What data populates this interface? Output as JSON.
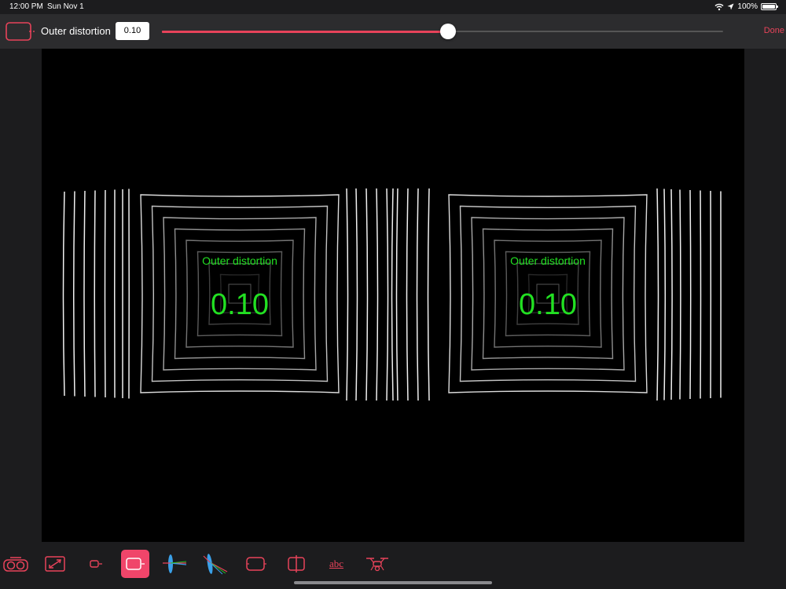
{
  "status": {
    "time": "12:00 PM",
    "date": "Sun Nov 1",
    "battery": "100%"
  },
  "toolbar": {
    "label": "Outer distortion",
    "value": "0.10",
    "slider_fraction": 0.51,
    "done_label": "Done"
  },
  "viewport": {
    "left_eye": {
      "label": "Outer distortion",
      "value": "0.10"
    },
    "right_eye": {
      "label": "Outer distortion",
      "value": "0.10"
    }
  },
  "bottom_tools": [
    {
      "name": "headset-tool",
      "icon": "vr-goggles-icon",
      "active": false
    },
    {
      "name": "scale-tool",
      "icon": "resize-diagonal-icon",
      "active": false
    },
    {
      "name": "inner-distortion-tool",
      "icon": "small-lens-icon",
      "active": false
    },
    {
      "name": "outer-distortion-tool",
      "icon": "large-lens-icon",
      "active": true
    },
    {
      "name": "lens-blue-tool",
      "icon": "lens-refraction-icon",
      "active": false
    },
    {
      "name": "lens-chromatic-tool",
      "icon": "chromatic-aberration-icon",
      "active": false
    },
    {
      "name": "screen-tool",
      "icon": "screen-frame-icon",
      "active": false
    },
    {
      "name": "split-screen-tool",
      "icon": "split-screen-icon",
      "active": false
    },
    {
      "name": "text-tool",
      "label": "abc",
      "active": false
    },
    {
      "name": "drone-tool",
      "icon": "drone-icon",
      "active": false
    }
  ],
  "colors": {
    "accent": "#e8435a",
    "active_tool": "#f0456a",
    "overlay_text": "#22e022",
    "background": "#000000"
  }
}
